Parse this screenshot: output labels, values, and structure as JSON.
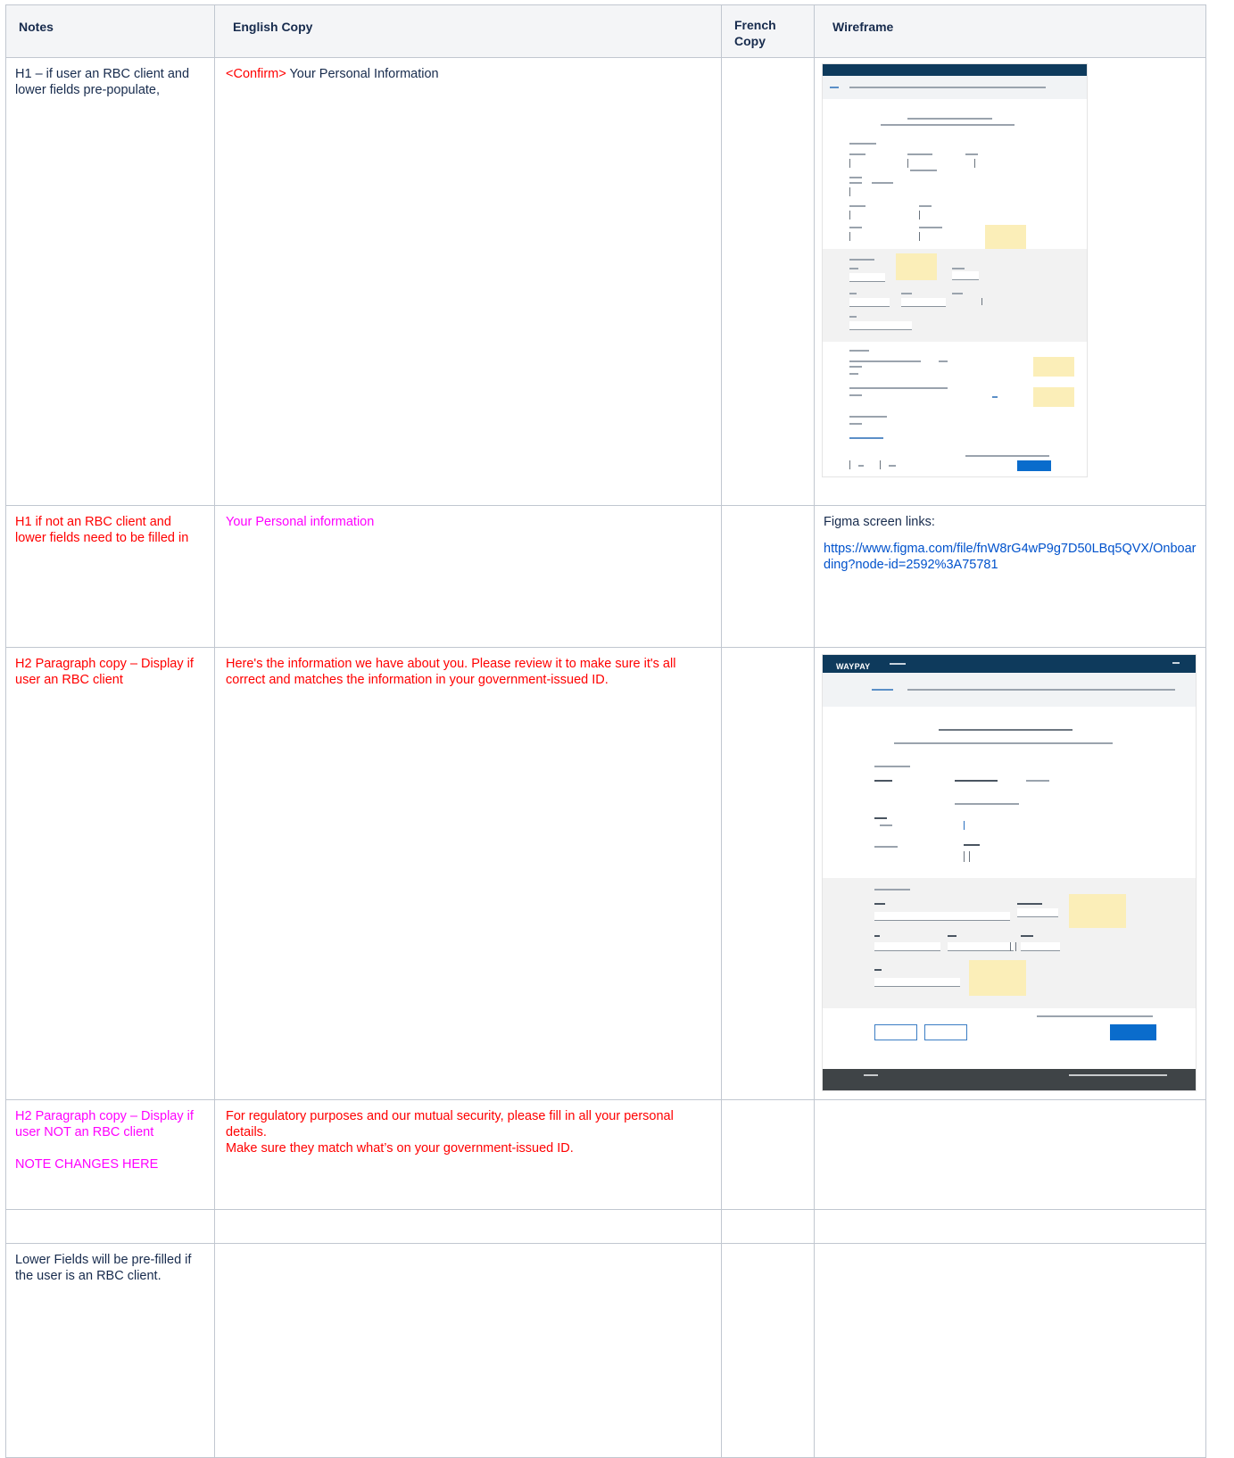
{
  "table": {
    "headers": [
      "Notes",
      "English Copy",
      "French Copy",
      "Wireframe"
    ],
    "rows": [
      {
        "notes": "H1 – if user an RBC client and lower fields pre-populate,",
        "english_prefix": "<Confirm>",
        "english_rest": " Your Personal Information",
        "french": "",
        "wireframe_type": "image"
      },
      {
        "notes": "H1 if not an RBC client and lower fields need to be filled in",
        "english": "Your Personal information",
        "french": "",
        "wireframe_label": "Figma screen links:",
        "wireframe_link": "https://www.figma.com/file/fnW8rG4wP9g7D50LBq5QVX/Onboarding?node-id=2592%3A75781"
      },
      {
        "notes": "H2 Paragraph copy – Display if user an RBC client",
        "english": "Here's the information we have about you. Please review it to make sure it's all correct and matches the information in your government-issued ID.",
        "french": "",
        "wireframe_type": "image",
        "wireframe_logo": "WAYPAY"
      },
      {
        "notes": "H2 Paragraph copy – Display if user NOT an RBC client",
        "notes_extra": "NOTE CHANGES HERE",
        "english_line1": "For regulatory purposes and our mutual security, please fill in all your personal details.",
        "english_line2": "Make sure they match what’s on your government-issued ID.",
        "french": "",
        "wireframe": ""
      },
      {
        "notes": "",
        "english": "",
        "french": "",
        "wireframe": ""
      },
      {
        "notes": "Lower Fields will be pre-filled if the user is an RBC client.",
        "english": "",
        "french": "",
        "wireframe": ""
      }
    ]
  },
  "colors": {
    "red": "#ff0000",
    "magenta": "#ff00ff",
    "link": "#0052cc",
    "header_bg": "#f4f5f7",
    "border": "#c1c7d0"
  }
}
